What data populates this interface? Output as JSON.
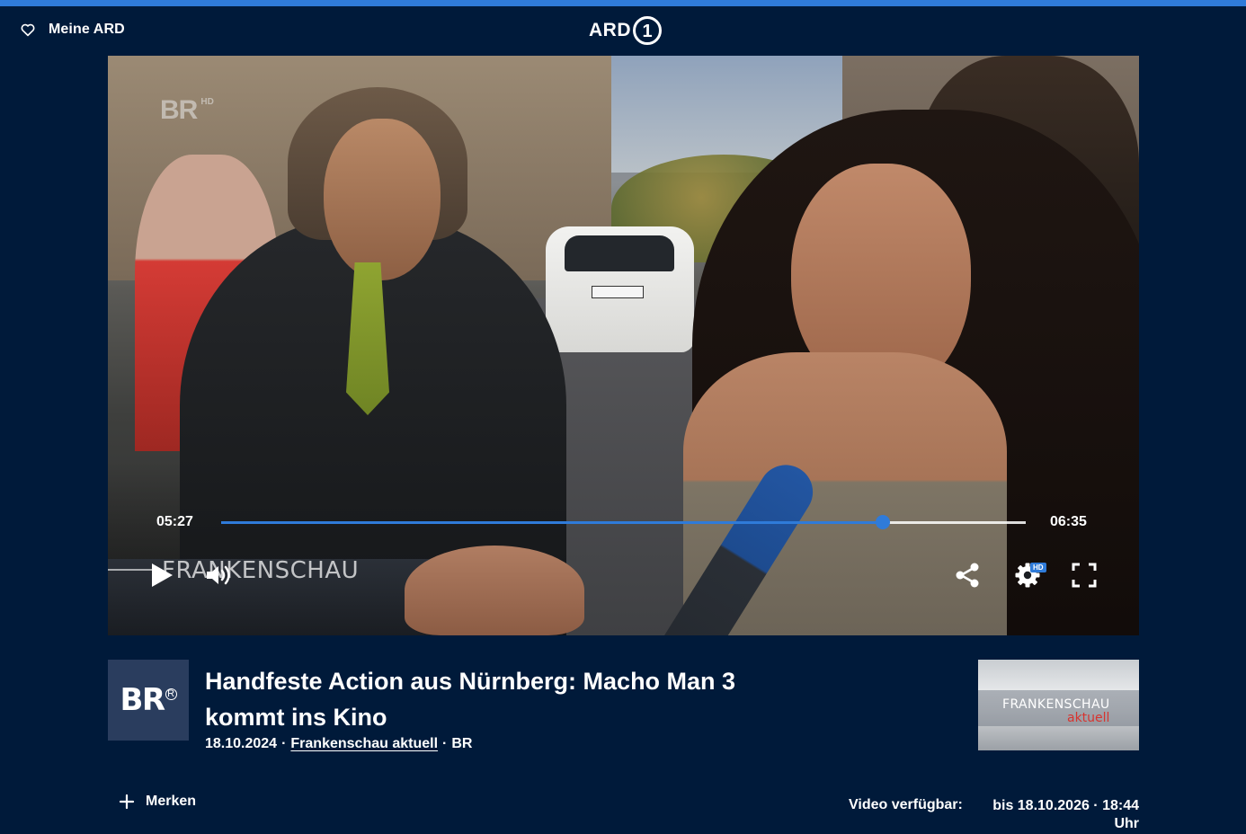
{
  "colors": {
    "background": "#001a3a",
    "accent": "#2f7bd9",
    "brand_red": "#d7342f"
  },
  "header": {
    "meine_ard_label": "Meine ARD",
    "logo_text": "ARD",
    "logo_number": "1"
  },
  "player": {
    "watermark": {
      "channel": "BR",
      "quality": "HD"
    },
    "lower_third": "FRANKENSCHAU",
    "current_time": "05:27",
    "total_time": "06:35",
    "progress_fraction": 0.8226,
    "hd_badge": "HD",
    "icons": [
      "play-icon",
      "volume-icon",
      "share-icon",
      "settings-icon",
      "fullscreen-icon"
    ]
  },
  "video": {
    "channel_logo": "BR",
    "title": "Handfeste Action aus Nürnberg: Macho Man 3 kommt ins Kino",
    "date": "18.10.2024",
    "separator": "·",
    "show_link": "Frankenschau aktuell",
    "broadcaster": "BR",
    "thumbnail": {
      "line1": "FRANKENSCHAU",
      "line2": "aktuell"
    }
  },
  "actions": {
    "merken_label": "Merken"
  },
  "availability": {
    "label": "Video verfügbar:",
    "value": "bis 18.10.2026 · 18:44 Uhr"
  }
}
